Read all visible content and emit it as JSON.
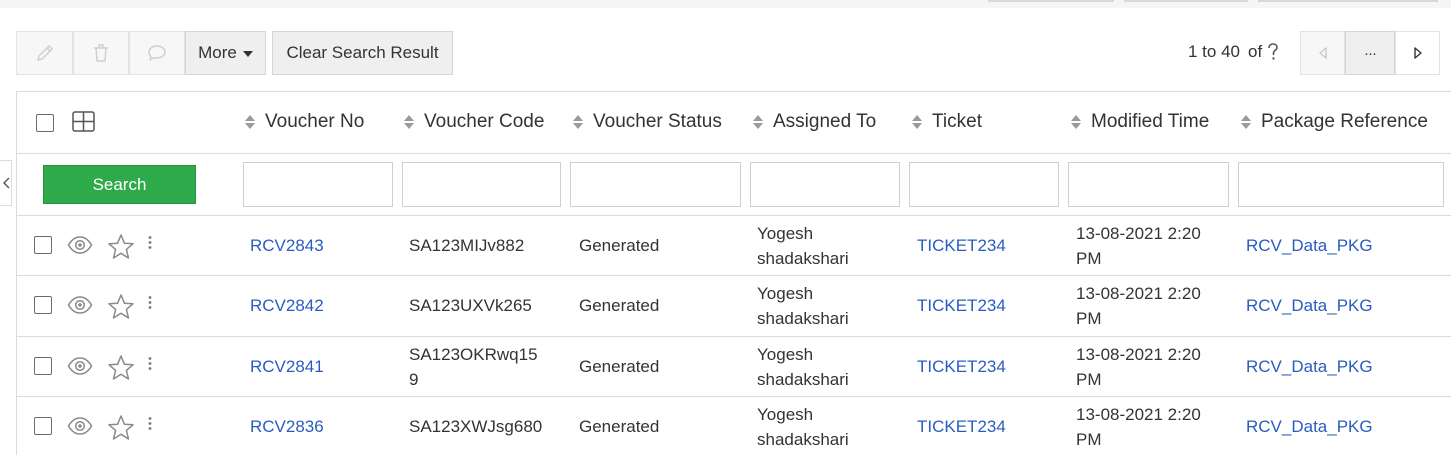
{
  "toolbar": {
    "more_label": "More",
    "clear_label": "Clear Search Result",
    "range_text": "1 to 40",
    "of_text": "of",
    "ellipsis": "···"
  },
  "table": {
    "columns": [
      "Voucher No",
      "Voucher Code",
      "Voucher Status",
      "Assigned To",
      "Ticket",
      "Modified Time",
      "Package Reference"
    ],
    "search_label": "Search",
    "rows": [
      {
        "voucher_no": "RCV2843",
        "voucher_code": "SA123MIJv882",
        "status": "Generated",
        "assigned_line1": "Yogesh",
        "assigned_line2": "shadakshari",
        "ticket": "TICKET234",
        "time_line1": "13-08-2021 2:20",
        "time_line2": "PM",
        "package": "RCV_Data_PKG"
      },
      {
        "voucher_no": "RCV2842",
        "voucher_code": "SA123UXVk265",
        "status": "Generated",
        "assigned_line1": "Yogesh",
        "assigned_line2": "shadakshari",
        "ticket": "TICKET234",
        "time_line1": "13-08-2021 2:20",
        "time_line2": "PM",
        "package": "RCV_Data_PKG"
      },
      {
        "voucher_no": "RCV2841",
        "voucher_code_line1": "SA123OKRwq15",
        "voucher_code_line2": "9",
        "status": "Generated",
        "assigned_line1": "Yogesh",
        "assigned_line2": "shadakshari",
        "ticket": "TICKET234",
        "time_line1": "13-08-2021 2:20",
        "time_line2": "PM",
        "package": "RCV_Data_PKG"
      },
      {
        "voucher_no": "RCV2836",
        "voucher_code": "SA123XWJsg680",
        "status": "Generated",
        "assigned_line1": "Yogesh",
        "assigned_line2": "shadakshari",
        "ticket": "TICKET234",
        "time_line1": "13-08-2021 2:20",
        "time_line2": "PM",
        "package": "RCV_Data_PKG"
      }
    ]
  },
  "colors": {
    "link": "#2a5cbf",
    "search_button": "#2faa4a"
  }
}
